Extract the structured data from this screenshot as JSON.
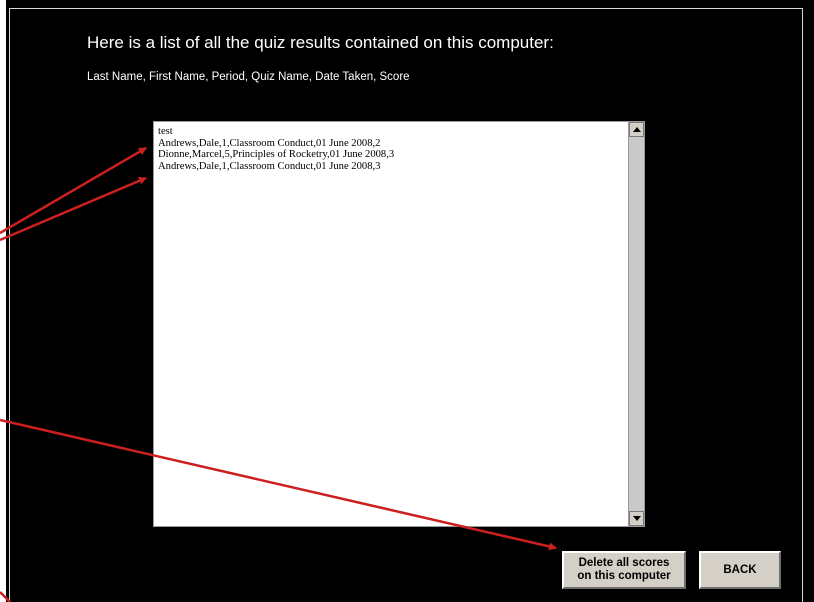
{
  "header": {
    "title": "Here is a list of all the quiz results contained on this computer:",
    "columns_caption": "Last Name, First Name, Period, Quiz Name, Date Taken, Score"
  },
  "results_box": {
    "lines": [
      "test",
      "Andrews,Dale,1,Classroom Conduct,01 June 2008,2",
      "Dionne,Marcel,5,Principles of Rocketry,01 June 2008,3",
      "Andrews,Dale,1,Classroom Conduct,01 June 2008,3"
    ]
  },
  "buttons": {
    "delete_line1": "Delete all scores",
    "delete_line2": "on this computer",
    "back_label": "BACK"
  },
  "colors": {
    "background": "#000000",
    "annotation_arrow": "#cc2020",
    "button_face": "#d4d0c8"
  }
}
